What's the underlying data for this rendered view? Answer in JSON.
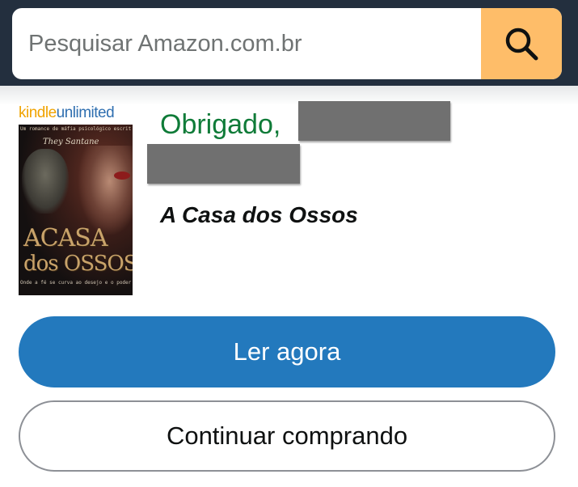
{
  "header": {
    "search": {
      "placeholder": "Pesquisar Amazon.com.br",
      "button_icon": "search-icon"
    }
  },
  "product": {
    "badge": {
      "part1": "kindle",
      "part2": "unlimited"
    },
    "cover": {
      "subtitle": "Um romance de máfia psicológico escrito por",
      "author": "They Santane",
      "title_line1": "ACASA",
      "title_line2": "dos OSSOS",
      "tagline": "Onde a fé se curva ao desejo e o poder reina"
    },
    "thanks_text": "Obrigado,",
    "customer_name_redacted": true,
    "book_title": "A Casa dos Ossos"
  },
  "actions": {
    "read_now_label": "Ler agora",
    "continue_shopping_label": "Continuar comprando"
  },
  "colors": {
    "header_bg": "#232f3e",
    "search_button": "#febd69",
    "thanks_green": "#0f7b38",
    "primary_button": "#2379bd"
  }
}
